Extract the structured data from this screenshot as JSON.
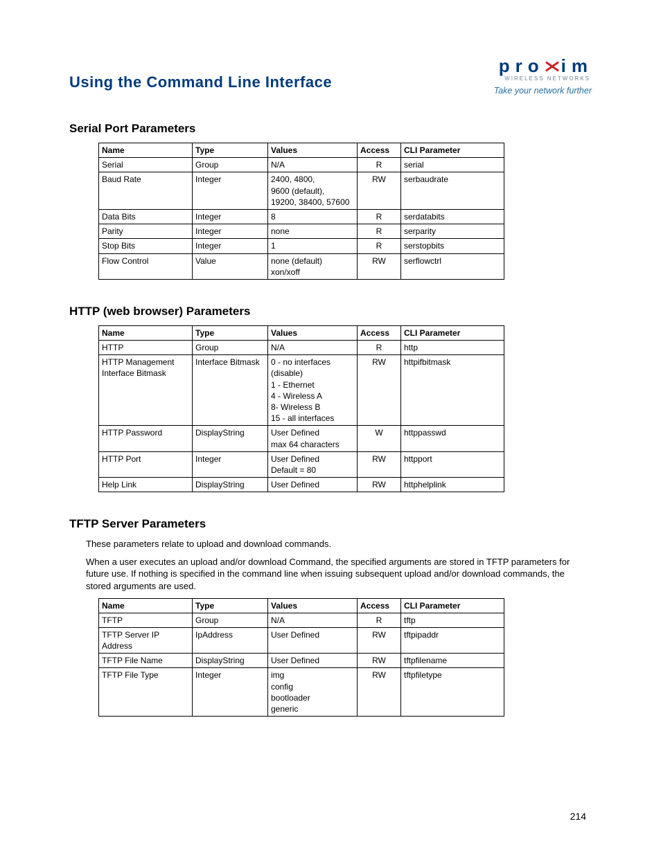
{
  "pageTitle": "Using the Command Line Interface",
  "logo": {
    "name": "proxim",
    "sub": "WIRELESS NETWORKS",
    "tagline": "Take your network further"
  },
  "columns": {
    "name": "Name",
    "type": "Type",
    "values": "Values",
    "access": "Access",
    "cli": "CLI Parameter"
  },
  "sections": [
    {
      "title": "Serial Port Parameters",
      "paragraphs": [],
      "rows": [
        {
          "name": "Serial",
          "type": "Group",
          "values": "N/A",
          "access": "R",
          "cli": "serial"
        },
        {
          "name": "Baud Rate",
          "type": "Integer",
          "values": "2400, 4800,\n9600 (default),\n19200, 38400, 57600",
          "access": "RW",
          "cli": "serbaudrate"
        },
        {
          "name": "Data Bits",
          "type": "Integer",
          "values": "8",
          "access": "R",
          "cli": "serdatabits"
        },
        {
          "name": "Parity",
          "type": "Integer",
          "values": "none",
          "access": "R",
          "cli": "serparity"
        },
        {
          "name": "Stop Bits",
          "type": "Integer",
          "values": "1",
          "access": "R",
          "cli": "serstopbits"
        },
        {
          "name": "Flow Control",
          "type": "Value",
          "values": "none (default)\nxon/xoff",
          "access": "RW",
          "cli": "serflowctrl"
        }
      ]
    },
    {
      "title": "HTTP (web browser) Parameters",
      "paragraphs": [],
      "rows": [
        {
          "name": "HTTP",
          "type": "Group",
          "values": "N/A",
          "access": "R",
          "cli": "http"
        },
        {
          "name": "HTTP Management Interface Bitmask",
          "type": "Interface Bitmask",
          "values": "0 - no interfaces (disable)\n1 - Ethernet\n4 - Wireless A\n8- Wireless B\n15 - all interfaces",
          "access": "RW",
          "cli": "httpifbitmask"
        },
        {
          "name": "HTTP Password",
          "type": "DisplayString",
          "values": "User Defined\nmax 64 characters",
          "access": "W",
          "cli": "httppasswd"
        },
        {
          "name": "HTTP Port",
          "type": "Integer",
          "values": "User Defined\nDefault = 80",
          "access": "RW",
          "cli": "httpport"
        },
        {
          "name": "Help Link",
          "type": "DisplayString",
          "values": "User Defined",
          "access": "RW",
          "cli": "httphelplink"
        }
      ]
    },
    {
      "title": "TFTP Server Parameters",
      "paragraphs": [
        "These parameters relate to upload and download commands.",
        "When a user executes an upload and/or download Command, the specified arguments are stored in TFTP parameters for future use. If nothing is specified in the command line when issuing subsequent upload and/or download commands, the stored arguments are used."
      ],
      "rows": [
        {
          "name": "TFTP",
          "type": "Group",
          "values": "N/A",
          "access": "R",
          "cli": "tftp"
        },
        {
          "name": "TFTP Server IP Address",
          "type": "IpAddress",
          "values": "User Defined",
          "access": "RW",
          "cli": "tftpipaddr"
        },
        {
          "name": "TFTP File Name",
          "type": "DisplayString",
          "values": "User Defined",
          "access": "RW",
          "cli": "tftpfilename"
        },
        {
          "name": "TFTP File Type",
          "type": "Integer",
          "values": "img\nconfig\nbootloader\ngeneric",
          "access": "RW",
          "cli": "tftpfiletype"
        }
      ]
    }
  ],
  "pageNumber": "214"
}
